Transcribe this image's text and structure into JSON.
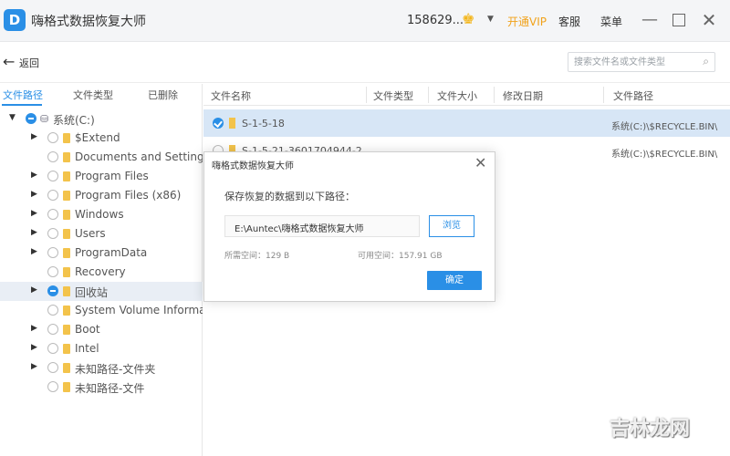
{
  "app": {
    "logo_letter": "D",
    "title": "嗨格式数据恢复大师",
    "account": "158629...",
    "vip": "开通VIP",
    "service": "客服",
    "menu": "菜单"
  },
  "toolbar": {
    "back_label": "返回",
    "search_placeholder": "搜索文件名或文件类型"
  },
  "left_tabs": [
    "文件路径",
    "文件类型",
    "已删除"
  ],
  "tree": [
    {
      "label": "系统(C:)",
      "level": 0,
      "expanded": true,
      "checked": true
    },
    {
      "label": "$Extend",
      "level": 1,
      "expandable": true
    },
    {
      "label": "Documents and Settings",
      "level": 1,
      "expandable": false
    },
    {
      "label": "Program Files",
      "level": 1,
      "expandable": true
    },
    {
      "label": "Program Files (x86)",
      "level": 1,
      "expandable": true
    },
    {
      "label": "Windows",
      "level": 1,
      "expandable": true
    },
    {
      "label": "Users",
      "level": 1,
      "expandable": true
    },
    {
      "label": "ProgramData",
      "level": 1,
      "expandable": true
    },
    {
      "label": "Recovery",
      "level": 1,
      "expandable": false
    },
    {
      "label": "回收站",
      "level": 1,
      "expandable": true,
      "checked": true,
      "selected": true
    },
    {
      "label": "System Volume Information",
      "level": 1,
      "expandable": false
    },
    {
      "label": "Boot",
      "level": 1,
      "expandable": true
    },
    {
      "label": "Intel",
      "level": 1,
      "expandable": true
    },
    {
      "label": "未知路径-文件夹",
      "level": 1,
      "expandable": true
    },
    {
      "label": "未知路径-文件",
      "level": 1,
      "expandable": false
    }
  ],
  "columns": [
    "文件名称",
    "文件类型",
    "文件大小",
    "修改日期",
    "文件路径"
  ],
  "files": [
    {
      "name": "S-1-5-18",
      "path": "系统(C:)\\$RECYCLE.BIN\\",
      "checked": true,
      "selected": true
    },
    {
      "name": "S-1-5-21-3601704944-2...",
      "path": "系统(C:)\\$RECYCLE.BIN\\",
      "checked": false,
      "selected": false
    }
  ],
  "dialog": {
    "title": "嗨格式数据恢复大师",
    "prompt": "保存恢复的数据到以下路径：",
    "path": "E:\\Auntec\\嗨格式数据恢复大师",
    "browse": "浏览",
    "need_space": "所需空间：129 B",
    "free_space": "可用空间：157.91 GB",
    "ok": "确定"
  },
  "watermark": "吉林龙网",
  "colors": {
    "accent": "#2a8fe6",
    "vip": "#f1a21a",
    "folder": "#f3c34b"
  }
}
